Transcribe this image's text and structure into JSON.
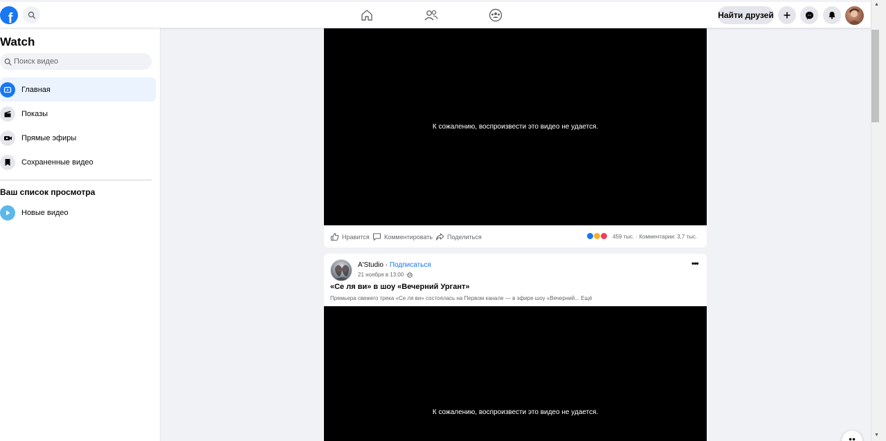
{
  "topbar": {
    "logo_letter": "f",
    "find_friends_label": "Найти друзей",
    "icons": [
      "home-icon",
      "friends-icon",
      "groups-icon",
      "plus-icon",
      "messenger-icon",
      "bell-icon"
    ]
  },
  "sidebar": {
    "title": "Watch",
    "search_placeholder": "Поиск видео",
    "items": [
      {
        "label": "Главная",
        "icon": "play-icon",
        "active": true
      },
      {
        "label": "Показы",
        "icon": "clapper-icon",
        "active": false
      },
      {
        "label": "Прямые эфиры",
        "icon": "live-camera-icon",
        "active": false
      },
      {
        "label": "Сохраненные видео",
        "icon": "bookmark-icon",
        "active": false
      }
    ],
    "watchlist_title": "Ваш список просмотра",
    "watchlist_items": [
      {
        "label": "Новые видео",
        "icon": "play-icon"
      }
    ]
  },
  "feed": {
    "video1": {
      "error_message": "К сожалению, воспроизвести это видео не удается.",
      "like_label": "Нравится",
      "comment_label": "Комментировать",
      "share_label": "Поделиться",
      "reaction_stats": "459 тыс. · Комментарии: 3,7 тыс."
    },
    "post2": {
      "author": "A'Studio",
      "separator": " · ",
      "follow_label": "Подписаться",
      "date": "21 ноября в 13:00 · ",
      "title": "«Се ля ви» в шоу «Вечерний Ургант»",
      "description": "Премьера свежего трека «Се ля ви» состоялась на Первом канале — в эфире шоу «Вечерний... Ещё",
      "more_label": "•••",
      "error_message": "К сожалению, воспроизвести это видео не удается."
    }
  },
  "colors": {
    "brand": "#1877f2",
    "background": "#f0f2f5",
    "active_item": "#ebf3ff"
  }
}
